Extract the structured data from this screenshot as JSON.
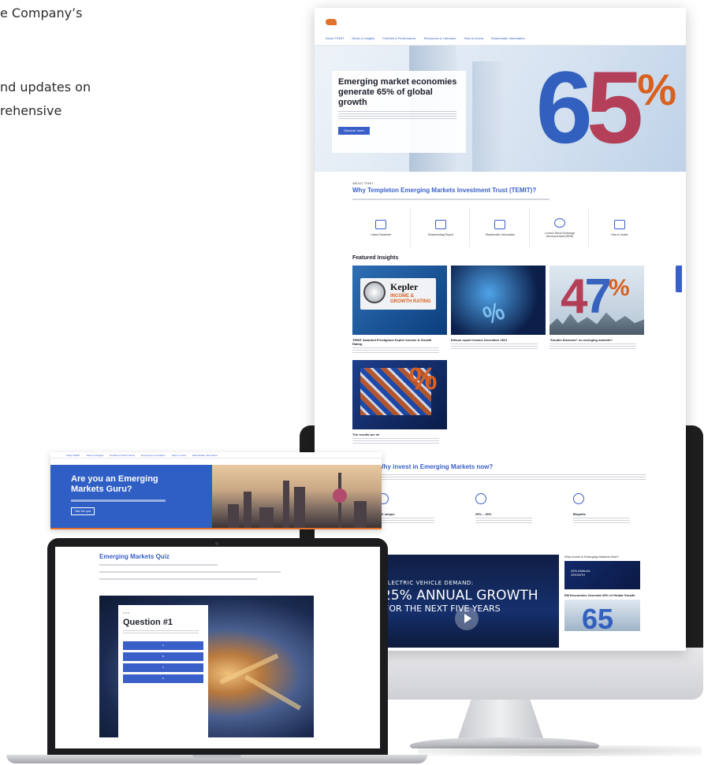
{
  "intro": {
    "line1": "e Company’s",
    "line2": "nd updates on",
    "line3": "rehensive"
  },
  "site": {
    "nav": [
      "About TEMIT",
      "News & Insights",
      "Portfolio & Performance",
      "Resources & Literature",
      "How to Invest",
      "Shareholder Information"
    ],
    "hero": {
      "headline": "Emerging market economies generate 65% of global growth",
      "big_number_digits": [
        "6",
        "5"
      ],
      "big_number_symbol": "%",
      "button": "Discover more"
    },
    "why": {
      "kicker": "ABOUT TEMIT",
      "title": "Why Templeton Emerging Markets Investment Trust (TEMIT)?",
      "features": [
        {
          "label": "Latest Factsheet",
          "icon": "monitor-icon"
        },
        {
          "label": "Shareholding Report",
          "icon": "chart-icon"
        },
        {
          "label": "Shareholder Information",
          "icon": "people-icon"
        },
        {
          "label": "London Stock Exchange Announcement (RNS)",
          "icon": "globe-icon"
        },
        {
          "label": "How to Invest",
          "icon": "bar-icon"
        }
      ]
    },
    "insights": {
      "title": "Featured Insights",
      "cards": [
        {
          "title": "TEMIT Awarded Prestigious Kepler Income & Growth Rating",
          "art": "Kepler",
          "art_sub": "INCOME & GROWTH RATING"
        },
        {
          "title": "Edison report issued, December 2021",
          "art": ""
        },
        {
          "title": "“Double Discount” on emerging markets?",
          "art": "47%"
        },
        {
          "title": "The results are in!",
          "art": "%"
        }
      ]
    },
    "why_now": {
      "title": "Why invest in Emerging Markets now?",
      "items": [
        {
          "title": "Still unique",
          "icon": "lightbulb-icon"
        },
        {
          "title": "20% – 30%",
          "icon": "diamond-icon"
        },
        {
          "title": "Biopolis",
          "icon": "network-icon"
        }
      ]
    },
    "video": {
      "line1": "ELECTRIC VEHICLE DEMAND:",
      "line2": "25% ANNUAL GROWTH",
      "line3": "FOR THE NEXT FIVE YEARS"
    },
    "side": {
      "title": "Why Invest in Emerging Markets Now?",
      "caption": "EM Economies Generate 65% of Global Growth",
      "thumb_number": "65"
    }
  },
  "quiz_page": {
    "nav": [
      "About TEMIT",
      "News & Insights",
      "Portfolio & Performance",
      "Resources & Literature",
      "How to Invest",
      "Shareholder Information"
    ],
    "title": "Are you an Emerging Markets Guru?",
    "button": "Take the quiz"
  },
  "laptop": {
    "title": "Emerging Markets Quiz",
    "question_label": "1 of 6",
    "question": "Question #1",
    "options": [
      "A",
      "B",
      "C",
      "D"
    ]
  },
  "colors": {
    "accent_blue": "#3a5fc8",
    "accent_orange": "#d9601f",
    "accent_red": "#b0243f"
  }
}
